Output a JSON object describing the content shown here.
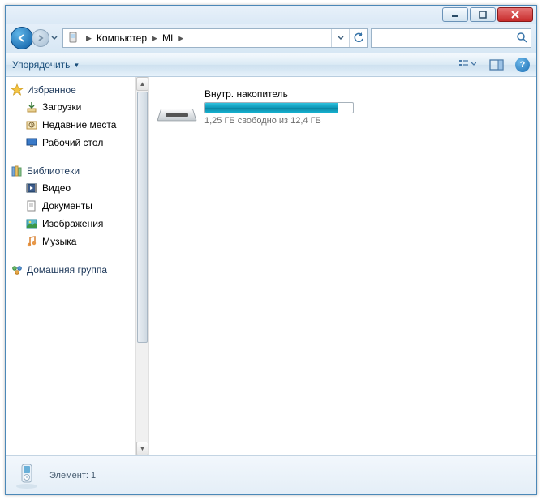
{
  "breadcrumbs": {
    "item0": "Компьютер",
    "item1": "MI"
  },
  "toolbar": {
    "organize": "Упорядочить"
  },
  "sidebar": {
    "group0": {
      "label": "Избранное",
      "items": [
        "Загрузки",
        "Недавние места",
        "Рабочий стол"
      ]
    },
    "group1": {
      "label": "Библиотеки",
      "items": [
        "Видео",
        "Документы",
        "Изображения",
        "Музыка"
      ]
    },
    "group2": {
      "label": "Домашняя группа"
    }
  },
  "drive": {
    "name": "Внутр. накопитель",
    "free_text": "1,25 ГБ свободно из 12,4 ГБ",
    "fill_percent": 90
  },
  "status": {
    "text": "Элемент: 1"
  }
}
